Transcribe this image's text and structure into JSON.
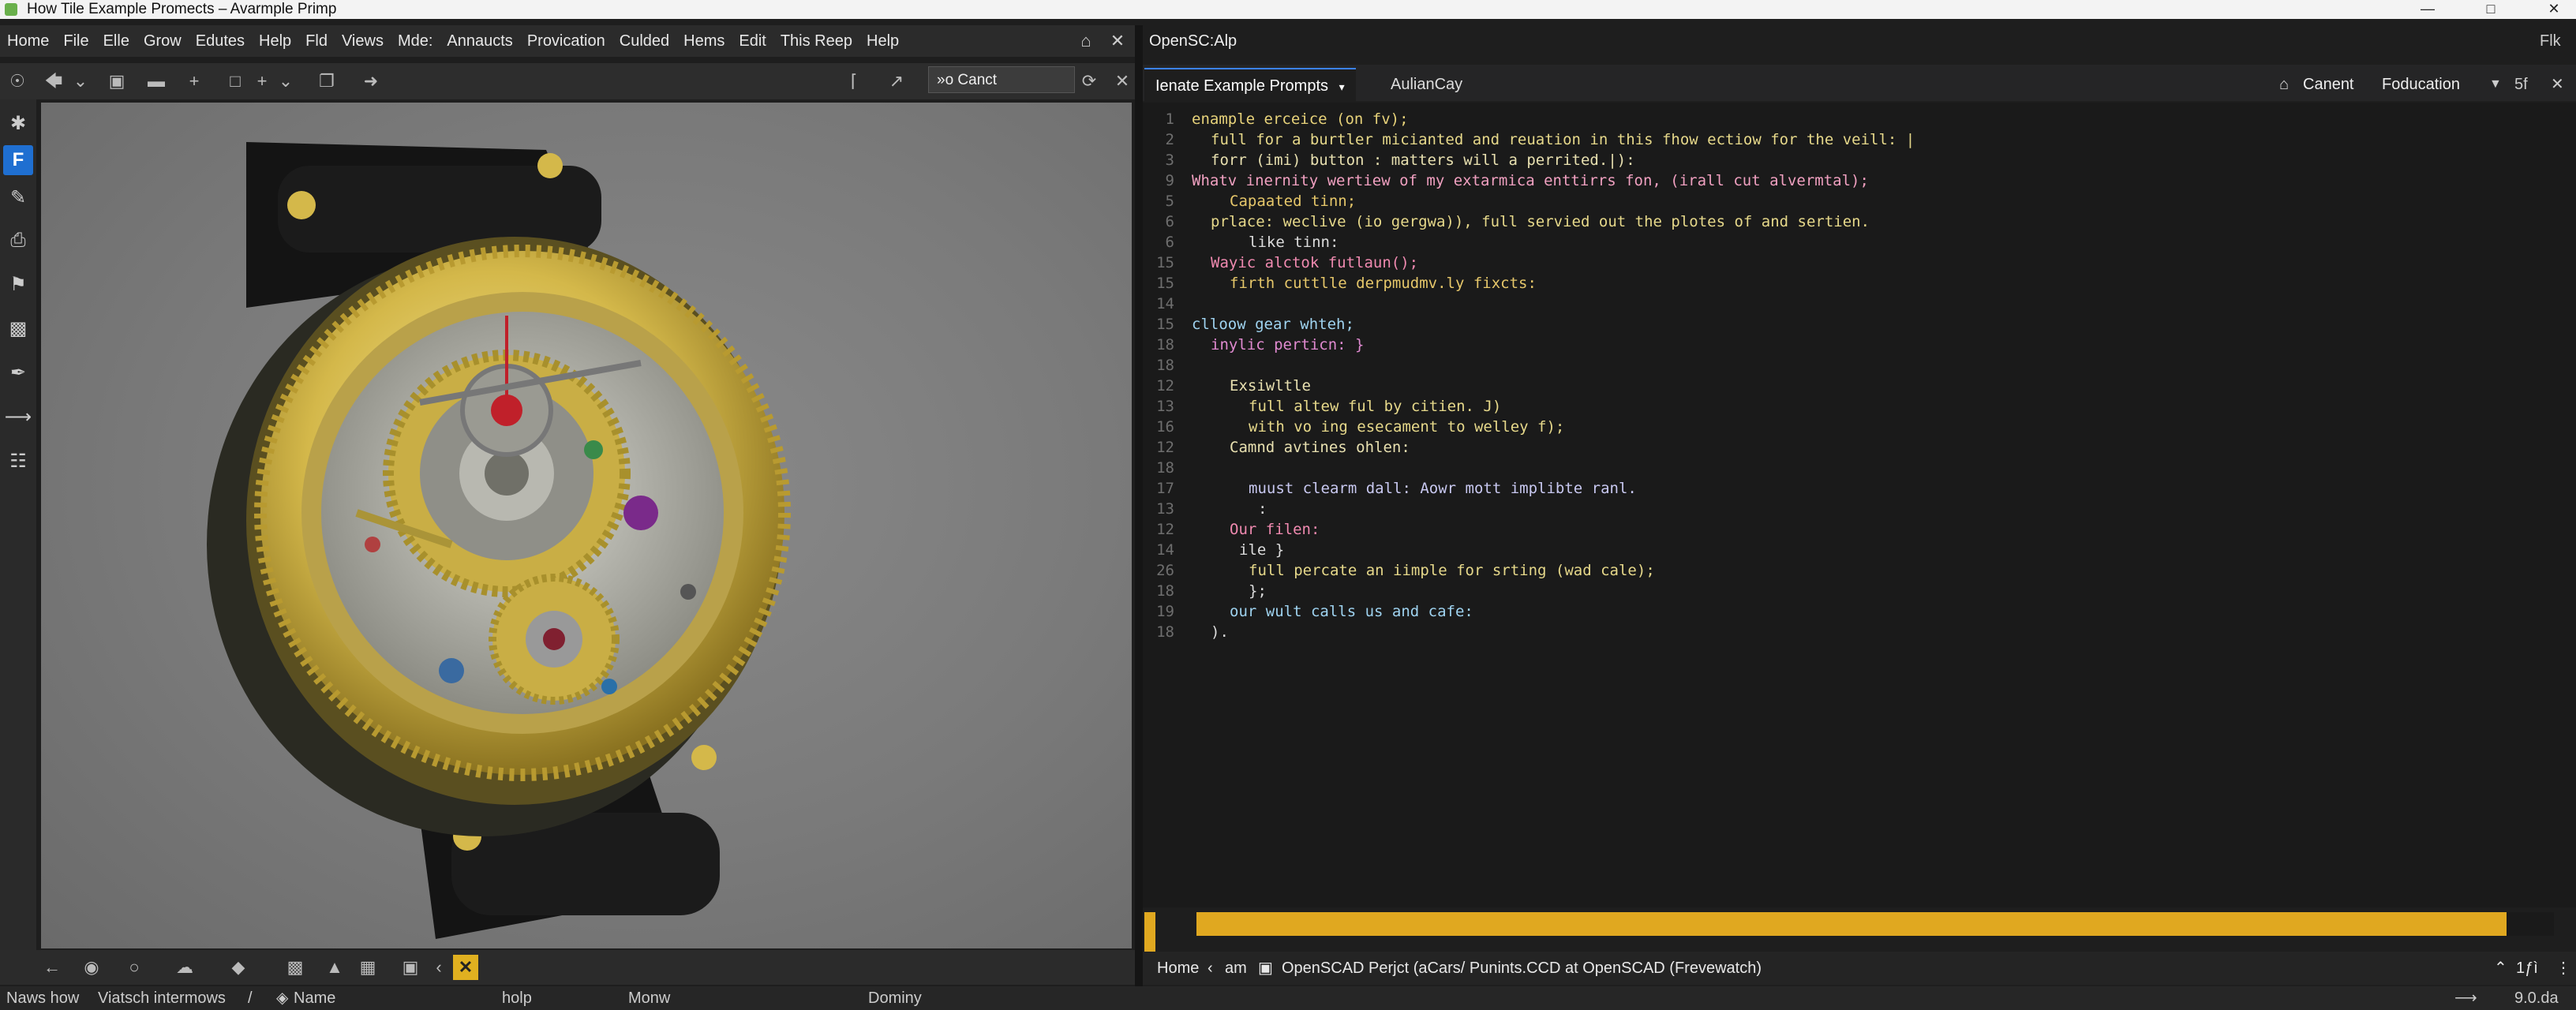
{
  "window": {
    "title": "How Tile  Example Promects  – Avarmple Primp",
    "controls": [
      "—",
      "□",
      "✕"
    ]
  },
  "menu": {
    "items": [
      "Home",
      "File",
      "Elle",
      "Grow",
      "Edutes",
      "Help",
      "Fld",
      "Views",
      "Mde:",
      "Annaucts",
      "Provication",
      "Culded",
      "Hems",
      "Edit",
      "This Reep",
      "Help"
    ]
  },
  "toolbar": {
    "search_value": "»o Canct"
  },
  "right_header": {
    "title": "OpenSC:Alp",
    "right_text": "Flk"
  },
  "tabs": [
    {
      "label": "Ienate Example Prompts",
      "active": true
    },
    {
      "label": "AulianCay",
      "active": false
    }
  ],
  "tab_actions": {
    "home_label": "Canent",
    "fod_label": "Foducation",
    "zoom_label": "5f"
  },
  "code_lines": [
    {
      "n": "1",
      "t": "enample erceice (on fv);",
      "c": "#e7d27a",
      "i": 0
    },
    {
      "n": "2",
      "t": "full for a burtler micianted and reuation in this fhow ectiow for the veill: |",
      "c": "#e6d88a",
      "i": 2
    },
    {
      "n": "3",
      "t": "forr (imi) button : matters will a perrited.|):",
      "c": "#e8e0b0",
      "i": 2
    },
    {
      "n": "9",
      "t": "Whatv inernity wertiew of my extarmica enttirrs fon, (irall cut alvermtal);",
      "c": "#f0a0c0",
      "i": 0
    },
    {
      "n": "5",
      "t": "Capaated tinn;",
      "c": "#e6c76a",
      "i": 4
    },
    {
      "n": "6",
      "t": "prlace: weclive (io gergwa)), full servied out the plotes of and sertien.",
      "c": "#e6d88a",
      "i": 2
    },
    {
      "n": "6",
      "t": "like tinn:",
      "c": "#dcdcdc",
      "i": 6
    },
    {
      "n": "15",
      "t": "Wayic alctok futlaun();",
      "c": "#f08ab0",
      "i": 2
    },
    {
      "n": "15",
      "t": "firth cuttlle derpmudmv.ly fixcts:",
      "c": "#e6c76a",
      "i": 4
    },
    {
      "n": "14",
      "t": "",
      "c": "#dcdcdc",
      "i": 0
    },
    {
      "n": "15",
      "t": "clloow gear whteh;",
      "c": "#9fd3f0",
      "i": 0
    },
    {
      "n": "18",
      "t": "inylic perticn: }",
      "c": "#e08ad0",
      "i": 2
    },
    {
      "n": "18",
      "t": "",
      "c": "#dcdcdc",
      "i": 0
    },
    {
      "n": "12",
      "t": "Exsiwltle",
      "c": "#e8e0b0",
      "i": 4
    },
    {
      "n": "13",
      "t": "full altew ful by citien. J)",
      "c": "#e6d88a",
      "i": 6
    },
    {
      "n": "16",
      "t": "with vo ing esecament to welley f);",
      "c": "#e6d88a",
      "i": 6
    },
    {
      "n": "12",
      "t": "Camnd avtines ohlen:",
      "c": "#e8e0b0",
      "i": 4
    },
    {
      "n": "18",
      "t": "",
      "c": "#dcdcdc",
      "i": 0
    },
    {
      "n": "17",
      "t": "muust clearm dall: Aowr mott implibte ranl.",
      "c": "#c8c8f0",
      "i": 6
    },
    {
      "n": "13",
      "t": ":",
      "c": "#dcdcdc",
      "i": 7
    },
    {
      "n": "12",
      "t": "Our filen:",
      "c": "#f08ab0",
      "i": 4
    },
    {
      "n": "14",
      "t": "ile }",
      "c": "#dcdcdc",
      "i": 5
    },
    {
      "n": "26",
      "t": "full percate an iimple for srting (wad cale);",
      "c": "#e6d88a",
      "i": 6
    },
    {
      "n": "18",
      "t": "};",
      "c": "#dcdcdc",
      "i": 6
    },
    {
      "n": "19",
      "t": "our wult calls us and cafe:",
      "c": "#9fd3f0",
      "i": 4
    },
    {
      "n": "18",
      "t": ").",
      "c": "#dcdcdc",
      "i": 2
    }
  ],
  "progress": {
    "value": 0.965
  },
  "right_status": {
    "home": "Home",
    "am": "am",
    "project": "OpenSCAD Perjct (aCars/ Punints.CCD at OpenSCAD (Frevewatch)",
    "page": "1ƒì"
  },
  "bottom_bar": {
    "a": "Naws how",
    "b": "Viatsch intermows",
    "c": "Name",
    "d": "holp",
    "e": "Monw",
    "f": "Dominy",
    "g": "9.0.da"
  },
  "colors": {
    "accent": "#3b82f6",
    "warning": "#e0a820",
    "gold": "#d4b84a"
  }
}
